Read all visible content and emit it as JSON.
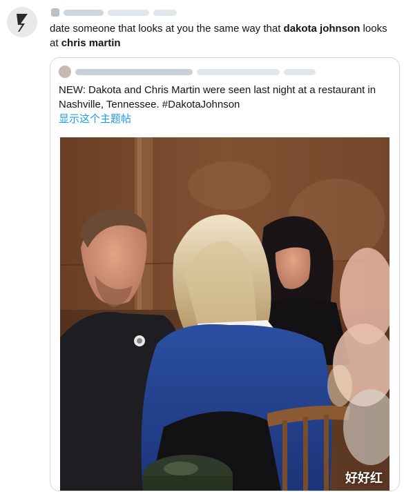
{
  "tweet": {
    "text_parts": {
      "p1": "date someone that looks at you the same way that ",
      "b1": "dakota johnson",
      "p2": " looks at ",
      "b2": "chris martin"
    }
  },
  "quoted_tweet": {
    "text": "NEW: Dakota and Chris Martin were seen last night at a restaurant in Nashville, Tennessee. #DakotaJohnson",
    "show_thread_link": "显示这个主题帖"
  },
  "watermark": "好好红",
  "icons": {
    "user_avatar": "avatar-icon",
    "quoted_avatar": "avatar-icon"
  },
  "colors": {
    "link": "#1d9bf0",
    "border": "#cfd9de",
    "text": "#0f1419"
  }
}
